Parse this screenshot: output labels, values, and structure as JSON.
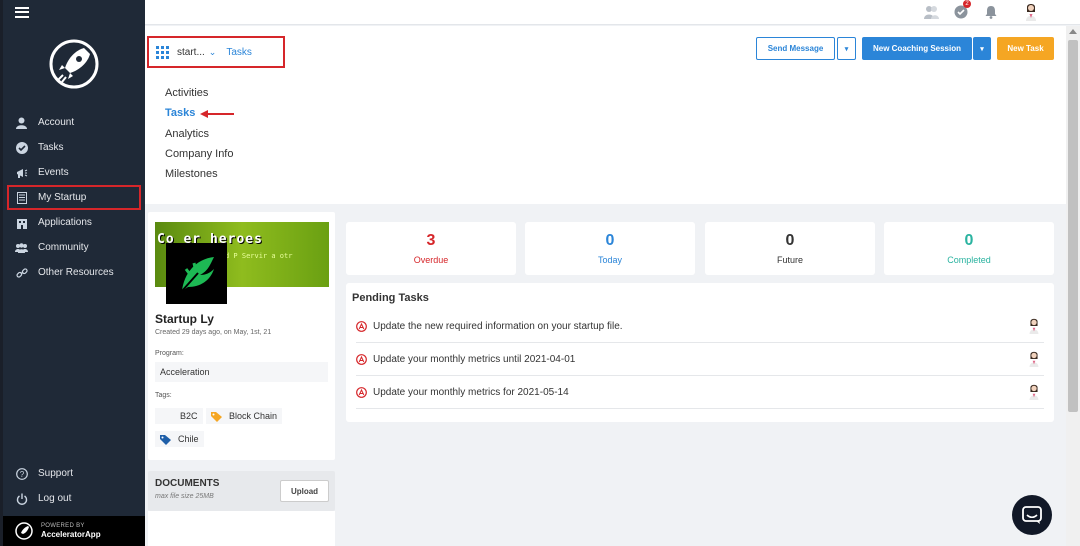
{
  "sidebar": {
    "items": [
      {
        "label": "Account",
        "icon": "user-icon"
      },
      {
        "label": "Tasks",
        "icon": "check-circle-icon"
      },
      {
        "label": "Events",
        "icon": "megaphone-icon"
      },
      {
        "label": "My Startup",
        "icon": "document-icon"
      },
      {
        "label": "Applications",
        "icon": "building-icon"
      },
      {
        "label": "Community",
        "icon": "people-icon"
      },
      {
        "label": "Other Resources",
        "icon": "link-icon"
      }
    ],
    "bottom": [
      {
        "label": "Support",
        "icon": "question-icon"
      },
      {
        "label": "Log out",
        "icon": "power-icon"
      }
    ],
    "powered_small": "POWERED BY",
    "powered_big": "AcceleratorApp"
  },
  "topbar": {
    "notification_count": "2"
  },
  "breadcrumb": {
    "startup": "start...",
    "current": "Tasks"
  },
  "subnav": [
    "Activities",
    "Tasks",
    "Analytics",
    "Company Info",
    "Milestones"
  ],
  "buttons": {
    "send_message": "Send Message",
    "new_coaching": "New Coaching Session",
    "new_task": "New Task"
  },
  "profile": {
    "banner_text": "Co  er heroes",
    "banner_sub": "d   P Servir a otr",
    "name": "Startup Ly",
    "created": "Created 29 days ago, on May, 1st, 21",
    "program_label": "Program:",
    "program": "Acceleration",
    "tags_label": "Tags:",
    "tags": [
      "B2C",
      "Block Chain",
      "Chile"
    ]
  },
  "documents": {
    "title": "DOCUMENTS",
    "sub": "max file size 25MB",
    "upload": "Upload"
  },
  "stats": [
    {
      "value": "3",
      "label": "Overdue",
      "color": "#d6262a"
    },
    {
      "value": "0",
      "label": "Today",
      "color": "#2b85d8"
    },
    {
      "value": "0",
      "label": "Future",
      "color": "#333333"
    },
    {
      "value": "0",
      "label": "Completed",
      "color": "#2ab3a0"
    }
  ],
  "pending": {
    "title": "Pending Tasks",
    "items": [
      "Update the new required information on your startup file.",
      "Update your monthly metrics until 2021-04-01",
      "Update your monthly metrics for 2021-05-14"
    ]
  },
  "colors": {
    "accent": "#2b85d8",
    "orange": "#f5a623",
    "highlight": "#d6262a",
    "sidebar": "#1f2937"
  }
}
